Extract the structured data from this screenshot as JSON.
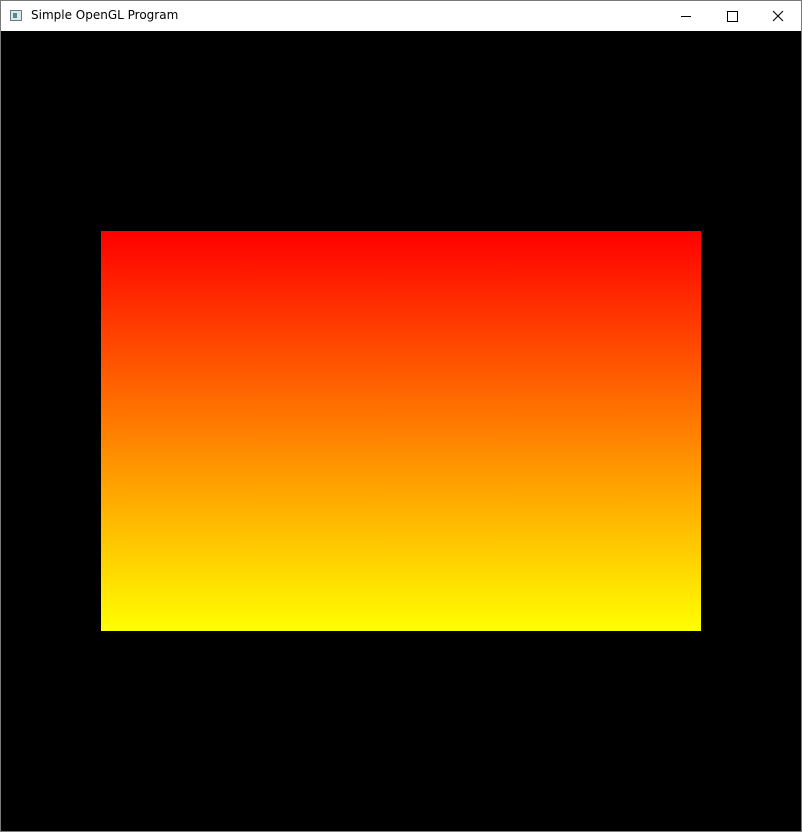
{
  "window": {
    "title": "Simple OpenGL Program",
    "icon": "app-window-icon",
    "controls": {
      "minimize_icon": "minimize-icon",
      "maximize_icon": "maximize-icon",
      "close_icon": "close-icon"
    }
  },
  "canvas": {
    "background": "#000000",
    "quad": {
      "gradient_top_color": "#ff0000",
      "gradient_bottom_color": "#ffff00"
    }
  }
}
